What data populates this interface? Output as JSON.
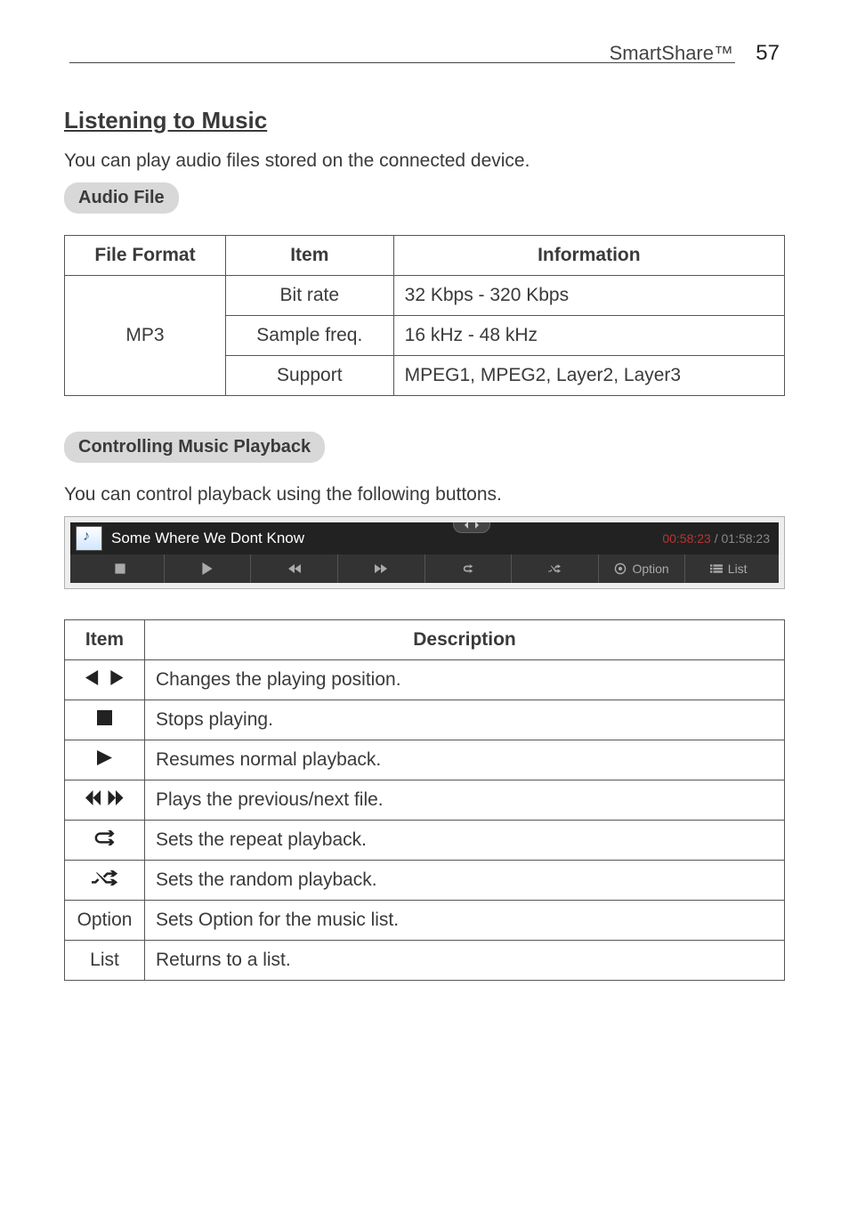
{
  "header": {
    "title": "SmartShare™",
    "page_number": "57"
  },
  "heading": "Listening to Music",
  "intro": "You can play audio files stored on the connected device.",
  "pill_audio_file": "Audio File",
  "table1": {
    "headers": [
      "File Format",
      "Item",
      "Information"
    ],
    "format": "MP3",
    "rows": [
      {
        "item": "Bit rate",
        "info": "32 Kbps - 320 Kbps"
      },
      {
        "item": "Sample freq.",
        "info": "16 kHz - 48 kHz"
      },
      {
        "item": "Support",
        "info": "MPEG1, MPEG2, Layer2, Layer3"
      }
    ]
  },
  "pill_controlling": "Controlling Music Playback",
  "controlling_intro": "You can control playback using the following buttons.",
  "player": {
    "track": "Some Where We Dont Know",
    "elapsed": "00:58:23",
    "separator": " / ",
    "total": "01:58:23",
    "option_label": "Option",
    "list_label": "List"
  },
  "table2": {
    "headers": [
      "Item",
      "Description"
    ],
    "rows": [
      {
        "icon": "leftright",
        "desc": "Changes the playing position."
      },
      {
        "icon": "stop",
        "desc": "Stops playing."
      },
      {
        "icon": "play",
        "desc": "Resumes normal playback."
      },
      {
        "icon": "prevnext",
        "desc": "Plays the previous/next file."
      },
      {
        "icon": "repeat",
        "desc": "Sets the repeat playback."
      },
      {
        "icon": "shuffle",
        "desc": "Sets the random playback."
      },
      {
        "text": "Option",
        "desc": "Sets Option for the music list."
      },
      {
        "text": "List",
        "desc": "Returns to a list."
      }
    ]
  }
}
